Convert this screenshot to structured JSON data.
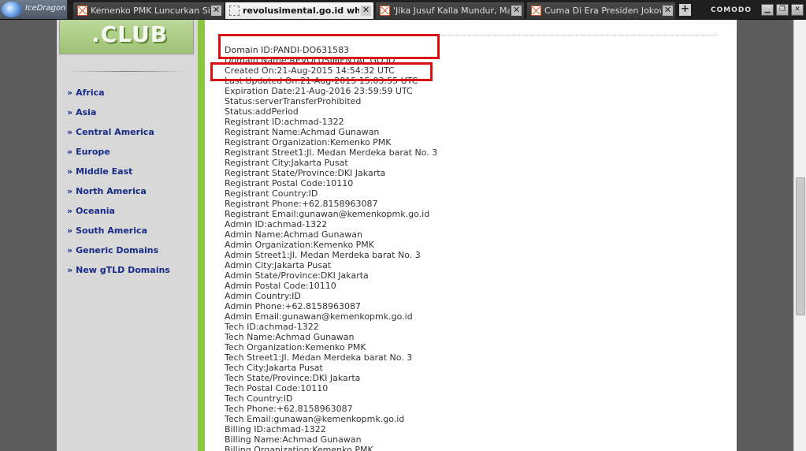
{
  "browser": {
    "app_name": "IceDragon",
    "tabs": [
      {
        "title": "Kemenko PMK Luncurkan Situs...",
        "active": false
      },
      {
        "title": "revolusimental.go.id who...",
        "active": true
      },
      {
        "title": "'Jika Jusuf Kalla Mundur, Mak...",
        "active": false
      },
      {
        "title": "Cuma Di Era Presiden Jokowi,...",
        "active": false
      }
    ],
    "new_tab": "+",
    "brand": "COMODO",
    "controls": {
      "minimize": "▁",
      "restore": "❐",
      "close": "✕"
    },
    "close_glyph": "✕"
  },
  "sidebar": {
    "banner_text": ".CLUB",
    "nav_marker": "»",
    "nav": [
      "Africa",
      "Asia",
      "Central America",
      "Europe",
      "Middle East",
      "North America",
      "Oceania",
      "South America",
      "Generic Domains",
      "New gTLD Domains"
    ]
  },
  "whois": [
    "Domain ID:PANDI-DO631583",
    "Domain Name:REVOLUSIMENTAL.GO.ID",
    "Created On:21-Aug-2015 14:54:32 UTC",
    "Last Updated On:21-Aug-2015 15:03:55 UTC",
    "Expiration Date:21-Aug-2016 23:59:59 UTC",
    "Status:serverTransferProhibited",
    "Status:addPeriod",
    "Registrant ID:achmad-1322",
    "Registrant Name:Achmad Gunawan",
    "Registrant Organization:Kemenko PMK",
    "Registrant Street1:Jl. Medan Merdeka barat No. 3",
    "Registrant City:Jakarta Pusat",
    "Registrant State/Province:DKI Jakarta",
    "Registrant Postal Code:10110",
    "Registrant Country:ID",
    "Registrant Phone:+62.8158963087",
    "Registrant Email:gunawan@kemenkopmk.go.id",
    "Admin ID:achmad-1322",
    "Admin Name:Achmad Gunawan",
    "Admin Organization:Kemenko PMK",
    "Admin Street1:Jl. Medan Merdeka barat No. 3",
    "Admin City:Jakarta Pusat",
    "Admin State/Province:DKI Jakarta",
    "Admin Postal Code:10110",
    "Admin Country:ID",
    "Admin Phone:+62.8158963087",
    "Admin Email:gunawan@kemenkopmk.go.id",
    "Tech ID:achmad-1322",
    "Tech Name:Achmad Gunawan",
    "Tech Organization:Kemenko PMK",
    "Tech Street1:Jl. Medan Merdeka barat No. 3",
    "Tech City:Jakarta Pusat",
    "Tech State/Province:DKI Jakarta",
    "Tech Postal Code:10110",
    "Tech Country:ID",
    "Tech Phone:+62.8158963087",
    "Tech Email:gunawan@kemenkopmk.go.id",
    "Billing ID:achmad-1322",
    "Billing Name:Achmad Gunawan",
    "Billing Organization:Kemenko PMK"
  ],
  "colors": {
    "highlight": "#d90f14",
    "accent_bar": "#8cc63e",
    "nav_link": "#172a86"
  }
}
